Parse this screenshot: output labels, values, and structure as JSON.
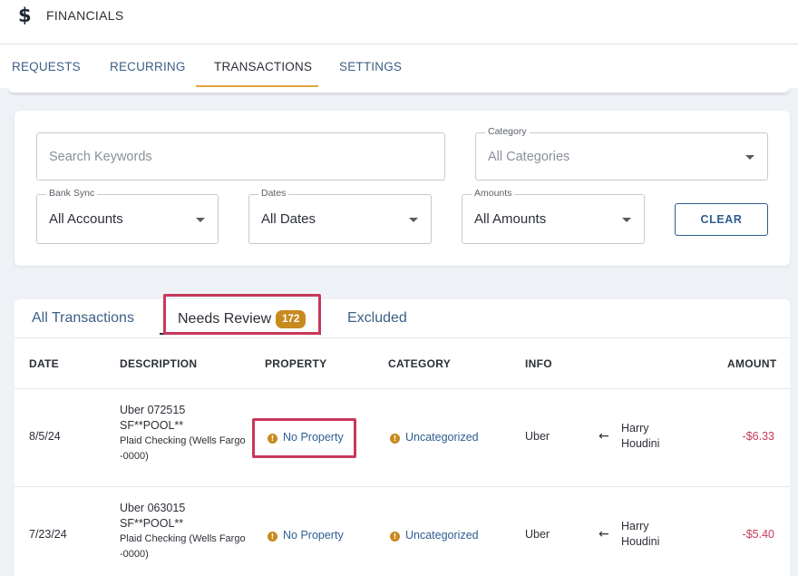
{
  "header": {
    "icon": "dollar-icon",
    "icon_glyph": "$",
    "title": "FINANCIALS"
  },
  "tabs": [
    {
      "label": "REQUESTS"
    },
    {
      "label": "RECURRING"
    },
    {
      "label": "TRANSACTIONS",
      "active": true
    },
    {
      "label": "SETTINGS"
    }
  ],
  "filters": {
    "search": {
      "placeholder": "Search Keywords"
    },
    "category": {
      "label": "Category",
      "value": "All Categories"
    },
    "bank_sync": {
      "label": "Bank Sync",
      "value": "All Accounts"
    },
    "dates": {
      "label": "Dates",
      "value": "All Dates"
    },
    "amounts": {
      "label": "Amounts",
      "value": "All Amounts"
    },
    "clear_label": "CLEAR"
  },
  "subtabs": {
    "all": "All Transactions",
    "review": "Needs Review",
    "review_count": "172",
    "excluded": "Excluded"
  },
  "table": {
    "headers": {
      "date": "DATE",
      "description": "DESCRIPTION",
      "property": "PROPERTY",
      "category": "CATEGORY",
      "info": "INFO",
      "amount": "AMOUNT"
    },
    "rows": [
      {
        "date": "8/5/24",
        "desc_line1": "Uber 072515",
        "desc_line2": "SF**POOL**",
        "desc_line3": "Plaid Checking (Wells Fargo",
        "desc_line4": "-0000)",
        "property": "No Property",
        "category": "Uncategorized",
        "info": "Uber",
        "payee_line1": "Harry",
        "payee_line2": "Houdini",
        "amount": "-$6.33"
      },
      {
        "date": "7/23/24",
        "desc_line1": "Uber 063015",
        "desc_line2": "SF**POOL**",
        "desc_line3": "Plaid Checking (Wells Fargo",
        "desc_line4": "-0000)",
        "property": "No Property",
        "category": "Uncategorized",
        "info": "Uber",
        "payee_line1": "Harry",
        "payee_line2": "Houdini",
        "amount": "-$5.40"
      }
    ]
  },
  "colors": {
    "accent": "#e0a53a",
    "link": "#2f5d92",
    "badge": "#c88a1f",
    "negative": "#c8385a",
    "highlight": "#c8385a"
  }
}
